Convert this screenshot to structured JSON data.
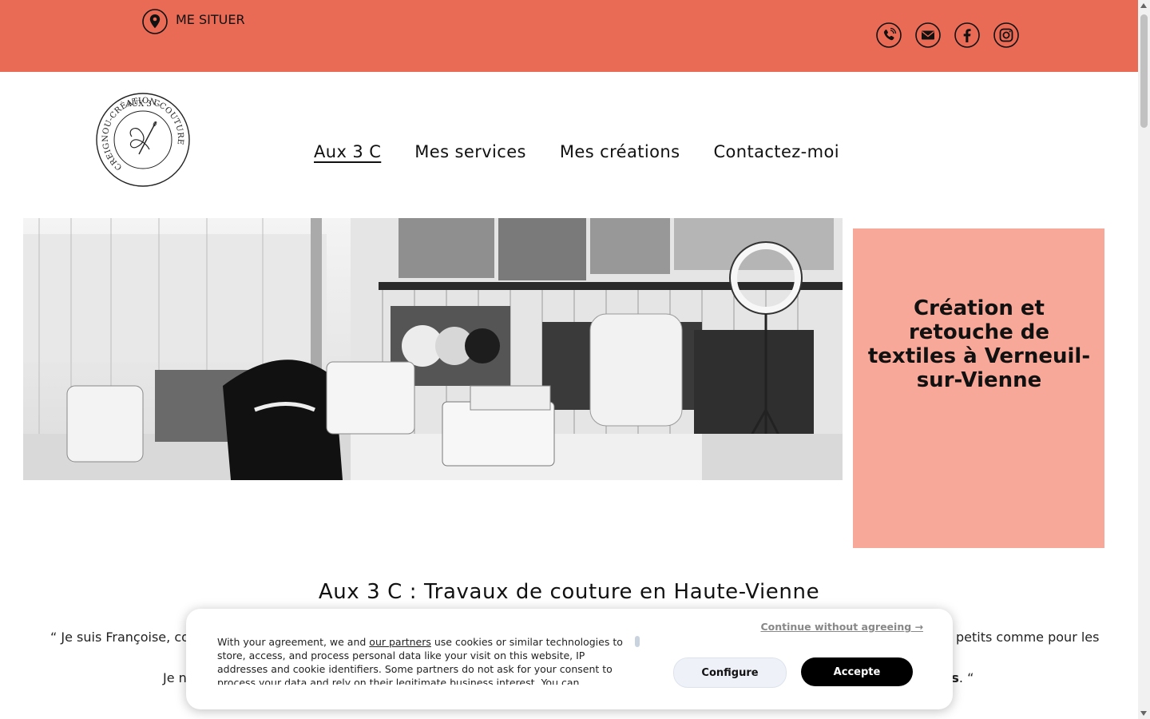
{
  "topbar": {
    "locate_label": "ME SITUER",
    "bg_color": "#e96b55",
    "social_icons": [
      "phone-icon",
      "mail-icon",
      "facebook-icon",
      "instagram-icon"
    ]
  },
  "logo": {
    "top_text": "AUX 3 C",
    "ring_text": "CREIGNOU-CRÉATION-COUTURE"
  },
  "nav": {
    "items": [
      {
        "label": "Aux 3 C",
        "active": true
      },
      {
        "label": "Mes services"
      },
      {
        "label": "Mes créations"
      },
      {
        "label": "Contactez-moi"
      }
    ]
  },
  "hero": {
    "headline": "Création et retouche de textiles à Verneuil-sur-Vienne",
    "box_color": "#f8a898"
  },
  "content": {
    "section_title": "Aux 3 C : Travaux de couture en Haute-Vienne",
    "para1_start": "“ Je suis Françoise, cou",
    "para1_end": "petits comme pour les",
    "para2_start": "Je n",
    "para2_end_bold": "ns",
    "para2_end": ". “"
  },
  "cookie": {
    "continue_label": "Continue without agreeing →",
    "body_prefix": "With your agreement, we and ",
    "partners_link": "our partners",
    "body_rest": " use cookies or similar technologies to store, access, and process personal data like your visit on this website, IP addresses and cookie identifiers. Some partners do not ask for your consent to process your data and rely on their legitimate business interest. You can",
    "configure_label": "Configure",
    "accept_label": "Accepte"
  }
}
